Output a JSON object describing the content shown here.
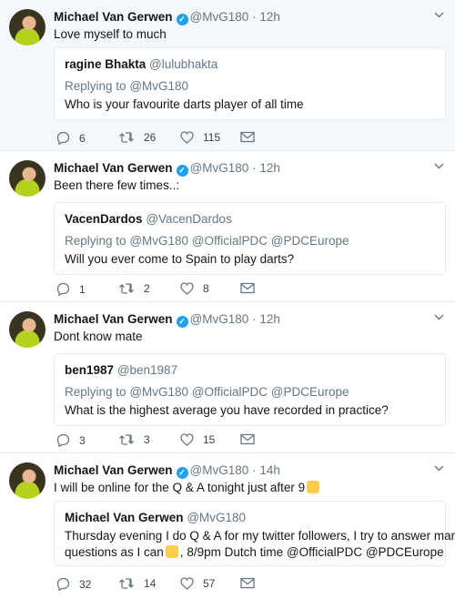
{
  "tweets": [
    {
      "name": "Michael Van Gerwen",
      "handle": "@MvG180",
      "separator": "·",
      "time": "12h",
      "text": "Love myself to much",
      "quote": {
        "name": "ragine Bhakta",
        "handle": "@lulubhakta",
        "replying": "Replying to",
        "replying_to": "@MvG180",
        "text": [
          "Who is your favourite darts player of all time"
        ]
      },
      "replies": "6",
      "retweets": "26",
      "likes": "115"
    },
    {
      "name": "Michael Van Gerwen",
      "handle": "@MvG180",
      "separator": "·",
      "time": "12h",
      "text": "Been there few times..:",
      "quote": {
        "name": "VacenDardos",
        "handle": "@VacenDardos",
        "replying": "Replying to",
        "replying_to": "@MvG180 @OfficialPDC @PDCEurope",
        "text": [
          "Will you ever come to Spain to play darts?"
        ]
      },
      "replies": "1",
      "retweets": "2",
      "likes": "8"
    },
    {
      "name": "Michael Van Gerwen",
      "handle": "@MvG180",
      "separator": "·",
      "time": "12h",
      "text": "Dont know mate",
      "quote": {
        "name": "ben1987",
        "handle": "@ben1987",
        "replying": "Replying to",
        "replying_to": "@MvG180 @OfficialPDC @PDCEurope",
        "text": [
          "What is the highest average you have recorded in practice?"
        ]
      },
      "replies": "3",
      "retweets": "3",
      "likes": "15"
    },
    {
      "name": "Michael Van Gerwen",
      "handle": "@MvG180",
      "separator": "·",
      "time": "14h",
      "text": "I will be online for the Q & A tonight just after 9",
      "quote": {
        "name": "Michael Van Gerwen",
        "handle": "@MvG180",
        "text": [
          "Thursday evening I do Q & A for my twitter followers, I try to answer many",
          "questions  as I can",
          ", 8/9pm Dutch time @OfficialPDC @PDCEurope"
        ]
      },
      "replies": "32",
      "retweets": "14",
      "likes": "57"
    }
  ],
  "icons": {
    "reply": "reply-icon",
    "retweet": "retweet-icon",
    "like": "heart-icon",
    "dm": "envelope-icon",
    "verified": "verified-badge-icon",
    "menu": "chevron-down-icon",
    "emoji": "thumbs-up-emoji"
  },
  "colors": {
    "accent": "#1da1f2",
    "secondary_text": "#657786",
    "highlight_bg": "#f5f8fa"
  }
}
